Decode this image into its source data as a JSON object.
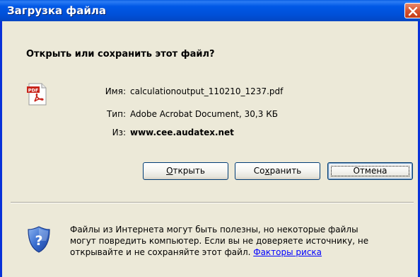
{
  "window": {
    "title": "Загрузка файла",
    "close_icon": "close-icon",
    "titlebar_color": "#0058e6",
    "close_color": "#d6532f"
  },
  "dialog": {
    "question": "Открыть или сохранить этот файл?",
    "file_icon": "pdf-icon",
    "fields": {
      "name_label": "Имя:",
      "name_value": "calculationoutput_110210_1237.pdf",
      "type_label": "Тип:",
      "type_value": "Adobe Acrobat Document, 30,3 КБ",
      "from_label": "Из:",
      "from_value": "www.cee.audatex.net"
    },
    "buttons": {
      "open_prefix": "О",
      "open_rest": "ткрыть",
      "save_prefix": "Со",
      "save_under": "х",
      "save_rest": "ранить",
      "cancel": "Отмена"
    }
  },
  "warning": {
    "icon": "shield-question-icon",
    "line1": "Файлы из Интернета могут быть полезны, но некоторые файлы",
    "line2": "могут повредить компьютер. Если вы не доверяете источнику, не",
    "line3_text": "открывайте и не сохраняйте этот файл. ",
    "link": "Факторы риска"
  }
}
